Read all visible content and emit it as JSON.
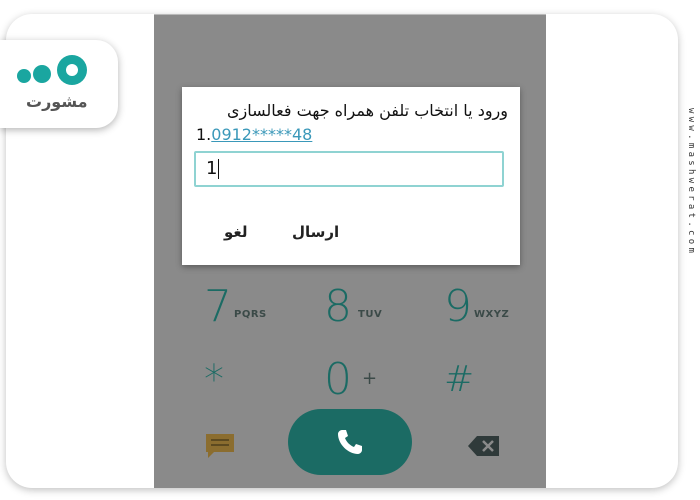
{
  "dialog": {
    "title": "ورود یا انتخاب تلفن همراه جهت فعالسازی",
    "option_prefix": "1.",
    "option_number": "0912*****48",
    "input_value": "1",
    "send_label": "ارسال",
    "cancel_label": "لغو"
  },
  "keypad": {
    "row1": [
      {
        "digit": "7",
        "letters": "PQRS"
      },
      {
        "digit": "8",
        "letters": "TUV"
      },
      {
        "digit": "9",
        "letters": "WXYZ"
      }
    ],
    "row2": [
      {
        "digit": "*"
      },
      {
        "digit": "0",
        "extra": "+"
      },
      {
        "digit": "#"
      }
    ]
  },
  "watermark": {
    "logo_text": "مشورت",
    "site": "www.mashwerat.com"
  },
  "colors": {
    "accent": "#1b6b64",
    "link": "#3a98b9",
    "input_border": "#8fd3d2",
    "overlay": "#8a8a8a"
  },
  "icons": {
    "call": "phone-icon",
    "message": "message-icon",
    "backspace": "backspace-icon"
  }
}
